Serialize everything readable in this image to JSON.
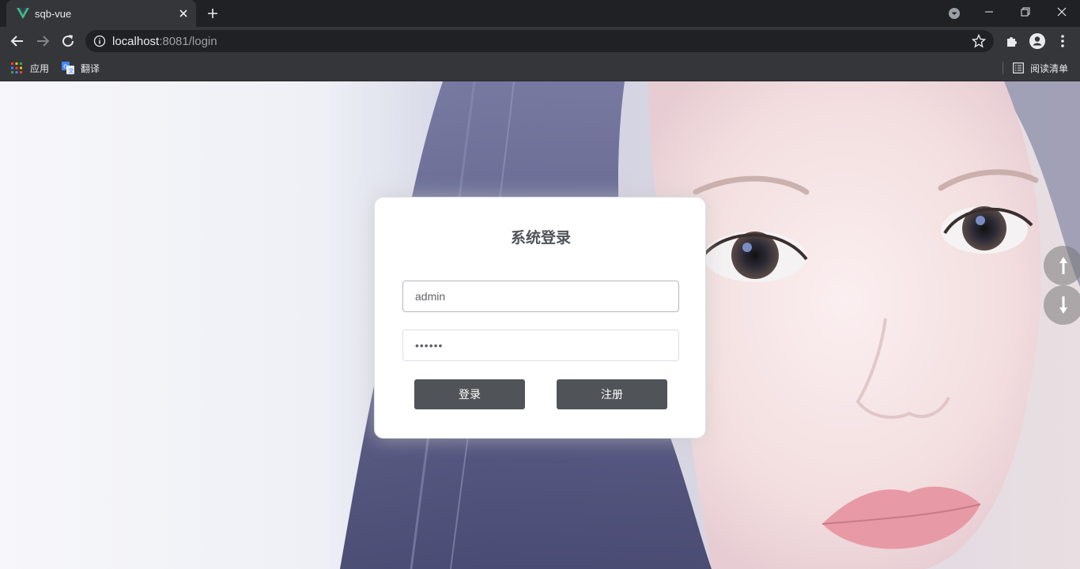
{
  "browser": {
    "tab": {
      "title": "sqb-vue",
      "favicon": "vue-logo-icon"
    },
    "url": {
      "host": "localhost",
      "rest": ":8081/login"
    },
    "bookmarks": [
      {
        "label": "应用",
        "icon": "apps-grid-icon"
      },
      {
        "label": "翻译",
        "icon": "translate-icon"
      }
    ],
    "reading_list": "阅读清单"
  },
  "login": {
    "title": "系统登录",
    "username_value": "admin",
    "password_value": "••••••",
    "login_label": "登录",
    "register_label": "注册"
  },
  "colors": {
    "button": "#505458",
    "browser_frame": "#202124",
    "toolbar": "#35363a"
  }
}
